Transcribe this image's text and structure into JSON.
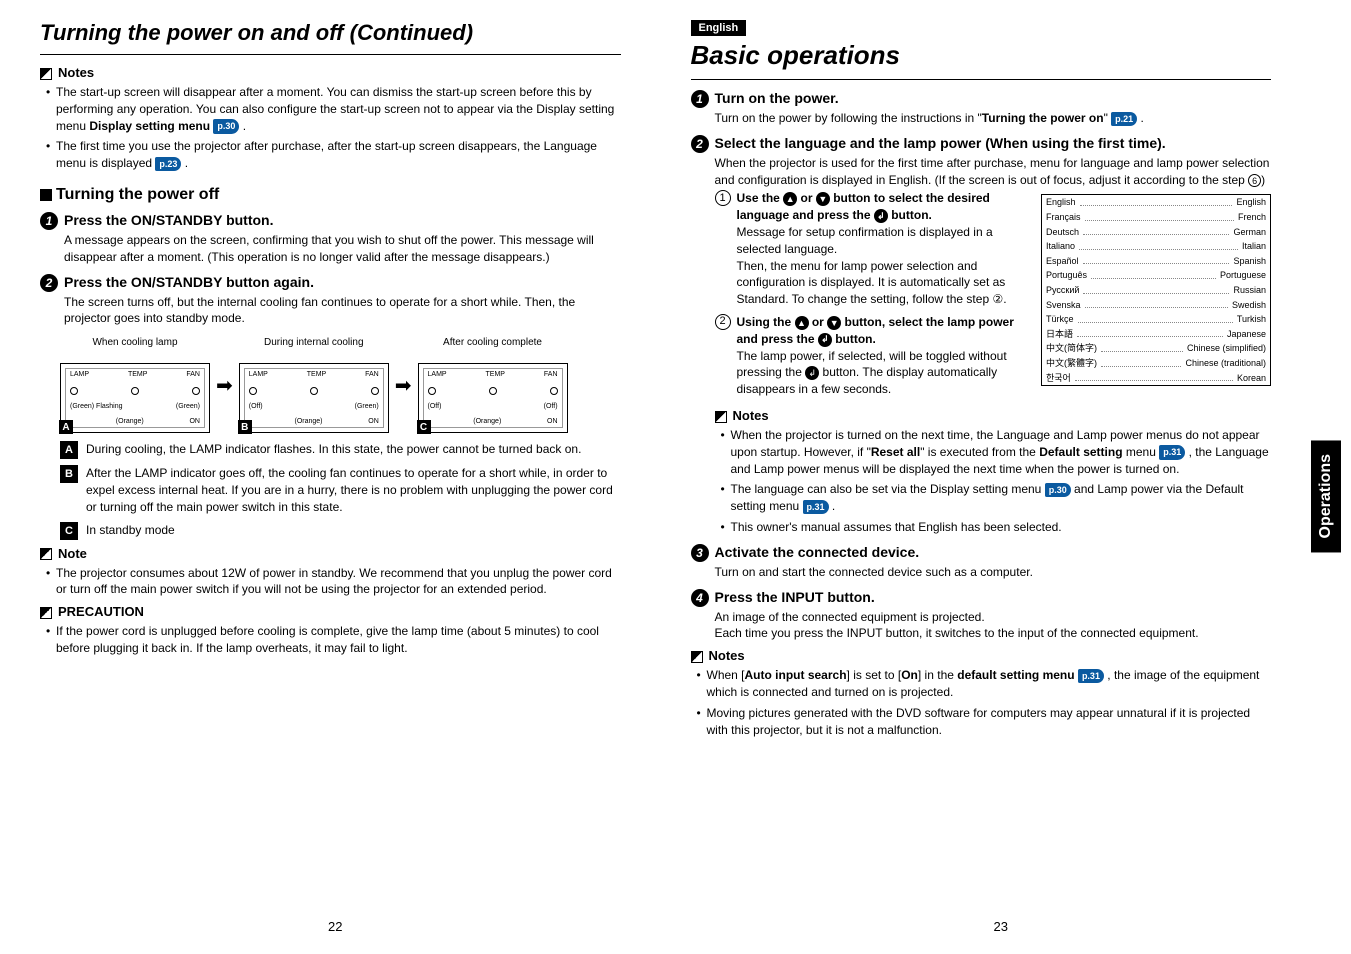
{
  "left": {
    "title": "Turning the power on and off (Continued)",
    "notes_header": "Notes",
    "notes": [
      "The start-up screen will disappear after a moment. You can dismiss the start-up screen before this by performing any operation. You can also configure the start-up screen not to appear via the Display setting menu",
      "The first time you use the projector after purchase, after the start-up screen disappears, the Language menu is displayed"
    ],
    "note1_ref": "p.30",
    "note2_ref": "p.23",
    "poweroff_h": "Turning the power off",
    "step1_title": "Press the ON/STANDBY button.",
    "step1_body": "A message appears on the screen, confirming that you wish to shut off the power. This message will disappear after a moment. (This operation is no longer valid after the message disappears.)",
    "step2_title": "Press the ON/STANDBY button again.",
    "step2_body": "The screen turns off, but the internal cooling fan continues to operate for a short while. Then, the projector goes into standby mode.",
    "diag": {
      "cap_a": "When cooling lamp",
      "cap_b": "During internal cooling",
      "cap_c": "After cooling complete",
      "lamp": "LAMP",
      "temp": "TEMP",
      "fan": "FAN",
      "on": "ON",
      "a_lamp": "(Green)\nFlashing",
      "a_fan": "(Green)",
      "a_on": "(Orange)",
      "b_lamp": "(Off)",
      "b_fan": "(Green)",
      "b_on": "(Orange)",
      "c_lamp": "(Off)",
      "c_fan": "(Off)",
      "c_on": "(Orange)"
    },
    "legend_a": "During cooling, the LAMP indicator flashes. In this state, the power cannot be turned back on.",
    "legend_b": "After the LAMP indicator goes off, the cooling fan continues to operate for a short while, in order to expel excess internal heat. If you are in a hurry, there is no problem with unplugging the power cord or turning off the main power switch in this state.",
    "legend_c": "In standby mode",
    "note_header": "Note",
    "note_single": "The projector consumes about 12W of power in standby. We recommend that you unplug the power cord or turn off the main power switch if you will not be using the projector for an extended period.",
    "precaution_header": "PRECAUTION",
    "precaution": "If the power cord is unplugged before cooling is complete, give the lamp time (about 5 minutes) to cool before plugging it back in. If the lamp overheats, it may fail to light.",
    "page_num": "22"
  },
  "right": {
    "lang_badge": "English",
    "title": "Basic operations",
    "step1_title": "Turn on the power.",
    "step1_body_pre": "Turn on the power by following the instructions in \"",
    "step1_body_bold": "Turning the power on",
    "step1_body_post": "\" ",
    "step1_ref": "p.21",
    "step2_title": "Select the language and the lamp power (When using the first time).",
    "step2_body": "When the projector is used for the first time after purchase, menu for language and lamp power selection and configuration is displayed in English. (If the screen is out of focus, adjust it according to the step ",
    "step2_body_ref": "6",
    "step2_body_end": ")",
    "sub1_title_a": "Use the ",
    "sub1_title_b": " or ",
    "sub1_title_c": " button to select the desired language and press the ",
    "sub1_title_d": " button.",
    "sub1_body": "Message for setup confirmation is displayed in a selected language.\nThen, the menu for lamp power selection and configuration is displayed. It is automatically set as Standard. To change the setting, follow the step ②.",
    "sub2_title_a": "Using the ",
    "sub2_title_b": " or ",
    "sub2_title_c": " button, select the lamp power and press the ",
    "sub2_title_d": " button.",
    "sub2_body": "The lamp power, if selected, will be toggled without pressing the  button. The display automatically disappears in a few seconds.",
    "notes_header": "Notes",
    "note_a_pre": "When the projector is turned on the next time, the Language and Lamp power menus do not appear upon startup. However, if \"",
    "note_a_bold1": "Reset all",
    "note_a_mid": "\" is executed from the ",
    "note_a_bold2": "Default setting",
    "note_a_post": " menu ",
    "note_a_ref": "p.31",
    "note_a_end": " , the Language and Lamp power menus will be displayed the next time when the power is turned on.",
    "note_b_pre": "The language can also be set via the Display setting menu ",
    "note_b_ref1": "p.30",
    "note_b_mid": " and Lamp power via the Default setting menu ",
    "note_b_ref2": "p.31",
    "note_c": "This owner's manual assumes that English has been selected.",
    "step3_title": "Activate the connected device.",
    "step3_body": "Turn on and start the connected device such as a computer.",
    "step4_title": "Press the INPUT button.",
    "step4_body": "An image of the connected equipment is projected.\nEach time you press the INPUT button, it switches to the input of the connected equipment.",
    "notes2_header": "Notes",
    "note2_a_pre": "When [",
    "note2_a_b1": "Auto input search",
    "note2_a_mid": "] is set to [",
    "note2_a_b2": "On",
    "note2_a_mid2": "] in the ",
    "note2_a_b3": "default setting menu",
    "note2_a_ref": "p.31",
    "note2_a_end": " , the image of the equipment which is connected and turned on is projected.",
    "note2_b": "Moving pictures generated with the DVD software for computers may appear unnatural if it is projected with this projector, but it is not a malfunction.",
    "lang_table": [
      {
        "l": "English",
        "r": "English"
      },
      {
        "l": "Français",
        "r": "French"
      },
      {
        "l": "Deutsch",
        "r": "German"
      },
      {
        "l": "Italiano",
        "r": "Italian"
      },
      {
        "l": "Español",
        "r": "Spanish"
      },
      {
        "l": "Português",
        "r": "Portuguese"
      },
      {
        "l": "Русский",
        "r": "Russian"
      },
      {
        "l": "Svenska",
        "r": "Swedish"
      },
      {
        "l": "Türkçe",
        "r": "Turkish"
      },
      {
        "l": "日本語",
        "r": "Japanese"
      },
      {
        "l": "中文(简体字)",
        "r": "Chinese (simplified)"
      },
      {
        "l": "中文(繁體字)",
        "r": "Chinese (traditional)"
      },
      {
        "l": "한국어",
        "r": "Korean"
      }
    ],
    "side_tab": "Operations",
    "page_num": "23"
  }
}
